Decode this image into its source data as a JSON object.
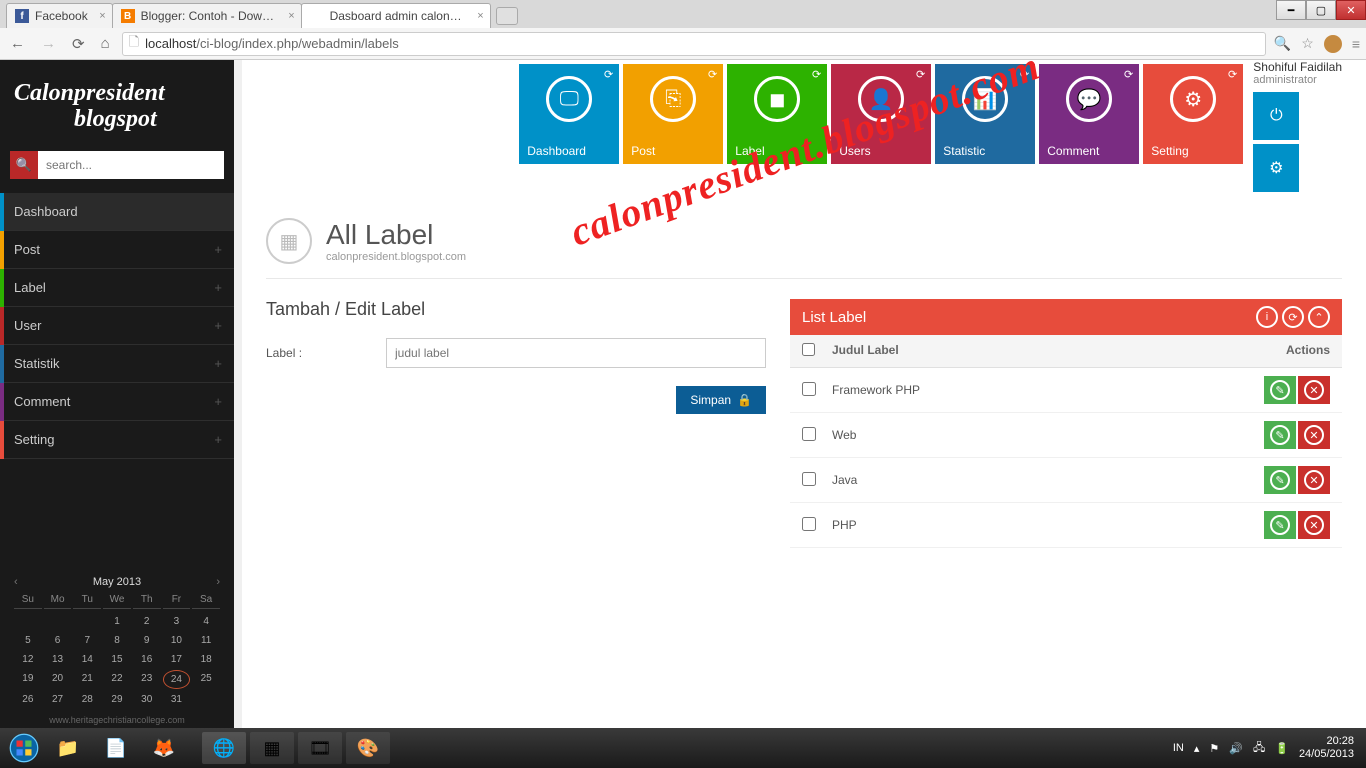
{
  "browser": {
    "tabs": [
      {
        "label": "Facebook",
        "favicon": "f"
      },
      {
        "label": "Blogger: Contoh - Downlo",
        "favicon": "B"
      },
      {
        "label": "Dasboard admin calonpre",
        "favicon": "X"
      }
    ],
    "url": "localhost/ci-blog/index.php/webadmin/labels",
    "url_host": "localhost"
  },
  "brand": {
    "line1": "Calonpresident",
    "line2": "blogspot"
  },
  "search": {
    "placeholder": "search..."
  },
  "sidebar": {
    "items": [
      {
        "label": "Dashboard",
        "color": "#0091c8",
        "active": true
      },
      {
        "label": "Post",
        "color": "#f2a000",
        "plus": true
      },
      {
        "label": "Label",
        "color": "#2db200",
        "plus": true
      },
      {
        "label": "User",
        "color": "#b92828",
        "plus": true
      },
      {
        "label": "Statistik",
        "color": "#1f6aa0",
        "plus": true
      },
      {
        "label": "Comment",
        "color": "#7a2c82",
        "plus": true
      },
      {
        "label": "Setting",
        "color": "#e74c3c",
        "plus": true
      }
    ]
  },
  "calendar": {
    "title": "May 2013",
    "dow": [
      "Su",
      "Mo",
      "Tu",
      "We",
      "Th",
      "Fr",
      "Sa"
    ],
    "leading_blanks": 3,
    "days": 31,
    "today": 24
  },
  "credit": "www.heritagechristiancollege.com",
  "tiles": [
    {
      "label": "Dashboard",
      "color": "#0091c8",
      "glyph": "🖵"
    },
    {
      "label": "Post",
      "color": "#f2a000",
      "glyph": "⎘"
    },
    {
      "label": "Label",
      "color": "#2db200",
      "glyph": "◼"
    },
    {
      "label": "Users",
      "color": "#b92846",
      "glyph": "👤"
    },
    {
      "label": "Statistic",
      "color": "#1f6aa0",
      "glyph": "📊"
    },
    {
      "label": "Comment",
      "color": "#7a2c82",
      "glyph": "💬"
    },
    {
      "label": "Setting",
      "color": "#e74c3c",
      "glyph": "⚙"
    }
  ],
  "user": {
    "name": "Shohiful Faidilah",
    "role": "administrator"
  },
  "small_tiles": [
    {
      "glyph": "⏻"
    },
    {
      "glyph": "⚙"
    }
  ],
  "page": {
    "title": "All Label",
    "subtitle": "calonpresident.blogspot.com"
  },
  "form": {
    "title": "Tambah / Edit Label",
    "label_text": "Label :",
    "placeholder": "judul label",
    "save": "Simpan"
  },
  "list": {
    "title": "List Label",
    "col_label": "Judul Label",
    "col_actions": "Actions",
    "rows": [
      "Framework PHP",
      "Web",
      "Java",
      "PHP"
    ]
  },
  "watermark": "calonpresident.blogspot.com",
  "taskbar": {
    "lang": "IN",
    "time": "20:28",
    "date": "24/05/2013"
  }
}
